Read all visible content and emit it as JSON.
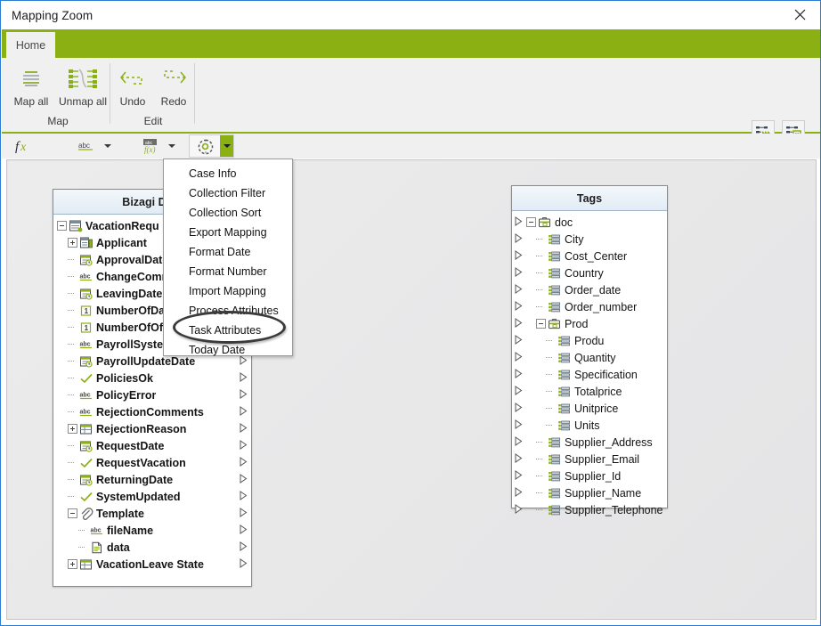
{
  "window": {
    "title": "Mapping Zoom",
    "close_icon": "close-icon"
  },
  "ribbon": {
    "tabs": [
      {
        "label": "Home",
        "active": true
      }
    ],
    "groups": [
      {
        "title": "Map",
        "buttons": [
          {
            "label": "Map all",
            "icon": "map-all-icon"
          },
          {
            "label": "Unmap all",
            "icon": "unmap-all-icon"
          }
        ]
      },
      {
        "title": "Edit",
        "buttons": [
          {
            "label": "Undo",
            "icon": "undo-arrow-icon"
          },
          {
            "label": "Redo",
            "icon": "redo-arrow-icon"
          }
        ]
      }
    ],
    "right_buttons": [
      {
        "icon": "auto-map-icon",
        "tooltip": ""
      },
      {
        "icon": "map-details-icon",
        "tooltip": ""
      }
    ]
  },
  "formula_bar": {
    "items": [
      {
        "icon": "fx-icon",
        "has_caret": false
      },
      {
        "icon": "abc-text-icon",
        "has_caret": true
      },
      {
        "icon": "function-fx-icon",
        "has_caret": true
      }
    ],
    "gear": {
      "icon": "gear-icon",
      "caret_icon": "chevron-down-icon"
    }
  },
  "menu": {
    "items": [
      "Case Info",
      "Collection Filter",
      "Collection Sort",
      "Export Mapping",
      "Format Date",
      "Format Number",
      "Import Mapping",
      "Process Attributes",
      "Task Attributes",
      "Today Date"
    ],
    "highlighted": "Task Attributes"
  },
  "left_panel": {
    "title": "Bizagi Data",
    "rows": [
      {
        "label": "VacationRequ",
        "icon": "entity-icon",
        "depth": 0,
        "toggle": "minus"
      },
      {
        "label": "Applicant",
        "icon": "subentity-icon",
        "depth": 1,
        "toggle": "plus"
      },
      {
        "label": "ApprovalDate",
        "icon": "date-icon",
        "depth": 1,
        "toggle": "none"
      },
      {
        "label": "ChangeComm",
        "icon": "abc-icon",
        "depth": 1,
        "toggle": "none"
      },
      {
        "label": "LeavingDate",
        "icon": "date-icon",
        "depth": 1,
        "toggle": "none"
      },
      {
        "label": "NumberOfDa",
        "icon": "number-icon",
        "depth": 1,
        "toggle": "none"
      },
      {
        "label": "NumberOfOff",
        "icon": "number-icon",
        "depth": 1,
        "toggle": "none"
      },
      {
        "label": "PayrollSystemCode",
        "icon": "abc-icon",
        "depth": 1,
        "toggle": "none"
      },
      {
        "label": "PayrollUpdateDate",
        "icon": "date-icon",
        "depth": 1,
        "toggle": "none"
      },
      {
        "label": "PoliciesOk",
        "icon": "check-icon",
        "depth": 1,
        "toggle": "none"
      },
      {
        "label": "PolicyError",
        "icon": "abc-icon",
        "depth": 1,
        "toggle": "none"
      },
      {
        "label": "RejectionComments",
        "icon": "abc-icon",
        "depth": 1,
        "toggle": "none"
      },
      {
        "label": "RejectionReason",
        "icon": "table-icon",
        "depth": 1,
        "toggle": "plus"
      },
      {
        "label": "RequestDate",
        "icon": "date-icon",
        "depth": 1,
        "toggle": "none"
      },
      {
        "label": "RequestVacation",
        "icon": "check-icon",
        "depth": 1,
        "toggle": "none"
      },
      {
        "label": "ReturningDate",
        "icon": "date-icon",
        "depth": 1,
        "toggle": "none"
      },
      {
        "label": "SystemUpdated",
        "icon": "check-icon",
        "depth": 1,
        "toggle": "none"
      },
      {
        "label": "Template",
        "icon": "attachment-icon",
        "depth": 1,
        "toggle": "minus"
      },
      {
        "label": "fileName",
        "icon": "abc-icon",
        "depth": 2,
        "toggle": "none"
      },
      {
        "label": "data",
        "icon": "file-icon",
        "depth": 2,
        "toggle": "none"
      },
      {
        "label": "VacationLeave State",
        "icon": "table-icon",
        "depth": 1,
        "toggle": "plus"
      }
    ]
  },
  "right_panel": {
    "title": "Tags",
    "rows": [
      {
        "label": "doc",
        "icon": "folder-tag-icon",
        "depth": 0,
        "toggle": "minus"
      },
      {
        "label": "City",
        "icon": "tag-icon",
        "depth": 1,
        "toggle": "none"
      },
      {
        "label": "Cost_Center",
        "icon": "tag-icon",
        "depth": 1,
        "toggle": "none"
      },
      {
        "label": "Country",
        "icon": "tag-icon",
        "depth": 1,
        "toggle": "none"
      },
      {
        "label": "Order_date",
        "icon": "tag-icon",
        "depth": 1,
        "toggle": "none"
      },
      {
        "label": "Order_number",
        "icon": "tag-icon",
        "depth": 1,
        "toggle": "none"
      },
      {
        "label": "Prod",
        "icon": "folder-tag-icon",
        "depth": 1,
        "toggle": "minus"
      },
      {
        "label": "Produ",
        "icon": "tag-icon",
        "depth": 2,
        "toggle": "none"
      },
      {
        "label": "Quantity",
        "icon": "tag-icon",
        "depth": 2,
        "toggle": "none"
      },
      {
        "label": "Specification",
        "icon": "tag-icon",
        "depth": 2,
        "toggle": "none"
      },
      {
        "label": "Totalprice",
        "icon": "tag-icon",
        "depth": 2,
        "toggle": "none"
      },
      {
        "label": "Unitprice",
        "icon": "tag-icon",
        "depth": 2,
        "toggle": "none"
      },
      {
        "label": "Units",
        "icon": "tag-icon",
        "depth": 2,
        "toggle": "none"
      },
      {
        "label": "Supplier_Address",
        "icon": "tag-icon",
        "depth": 1,
        "toggle": "none"
      },
      {
        "label": "Supplier_Email",
        "icon": "tag-icon",
        "depth": 1,
        "toggle": "none"
      },
      {
        "label": "Supplier_Id",
        "icon": "tag-icon",
        "depth": 1,
        "toggle": "none"
      },
      {
        "label": "Supplier_Name",
        "icon": "tag-icon",
        "depth": 1,
        "toggle": "none"
      },
      {
        "label": "Supplier_Telephone",
        "icon": "tag-icon",
        "depth": 1,
        "toggle": "none"
      }
    ]
  },
  "colors": {
    "accent_green": "#8ab014",
    "window_border": "#2b7cd3",
    "ribbon_bg": "#f0f0f0",
    "canvas_bg": "#e7e7e7",
    "panel_header": "#e2ecf5"
  }
}
